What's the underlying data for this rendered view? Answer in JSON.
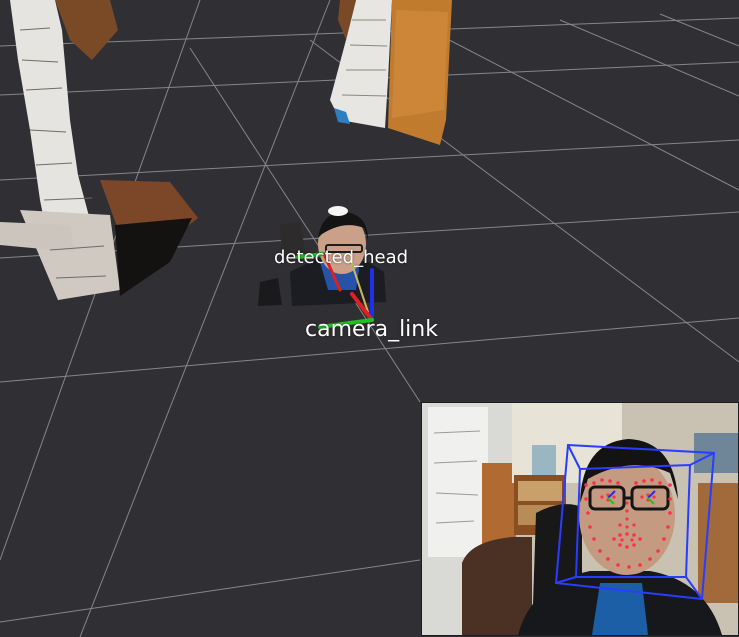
{
  "app": {
    "view_type": "3D point cloud viewer",
    "background_color": "#302f33",
    "grid_color": "#a3a3a7"
  },
  "tf_frames": [
    {
      "id": "detected_head",
      "label": "detected_head"
    },
    {
      "id": "camera_link",
      "label": "camera_link"
    }
  ],
  "axis_colors": {
    "x": "#e02020",
    "y": "#22c022",
    "z": "#2030e8"
  },
  "image_inset": {
    "description": "camera image with face landmarks and 3D head bounding box",
    "landmark_color": "#ff2f4a",
    "bbox_color": "#2a3cff"
  }
}
